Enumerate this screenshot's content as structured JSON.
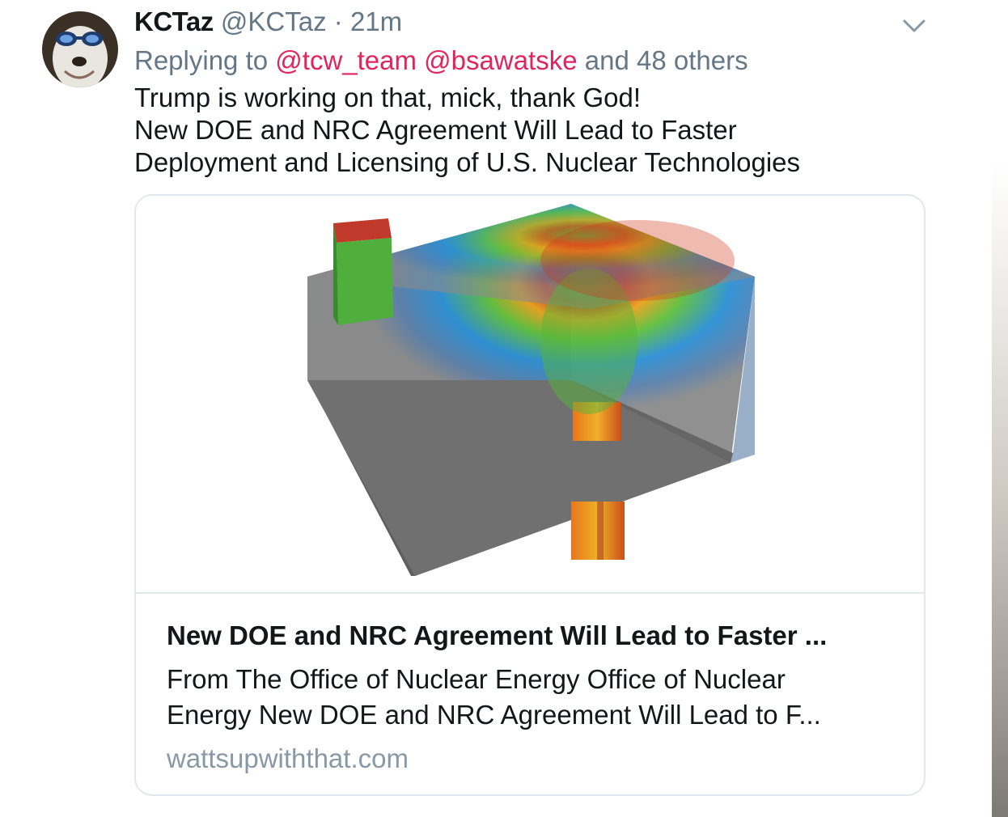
{
  "tweet": {
    "name": "KCTaz",
    "handle": "@KCTaz",
    "separator": "·",
    "time": "21m",
    "reply_prefix": "Replying to",
    "mention_1": "@tcw_team",
    "mention_2": "@bsawatske",
    "reply_suffix": "and 48 others",
    "text_lines": [
      "Trump is working on that, mick, thank God!",
      "New DOE and NRC Agreement Will Lead to Faster",
      "Deployment and Licensing of U.S. Nuclear Technologies"
    ]
  },
  "card": {
    "title": "New DOE and NRC Agreement Will Lead to Faster ...",
    "desc_lines": [
      "From The Office of Nuclear Energy Office of Nuclear",
      "Energy New DOE and NRC Agreement Will Lead to F..."
    ],
    "domain": "wattsupwiththat.com"
  },
  "icons": {
    "caret": "chevron-down-icon",
    "avatar": "avatar-image"
  },
  "colors": {
    "mention": "#e0245e",
    "secondary_text": "#657786",
    "domain_text": "#8899a6",
    "card_border": "#e1e8ed"
  }
}
